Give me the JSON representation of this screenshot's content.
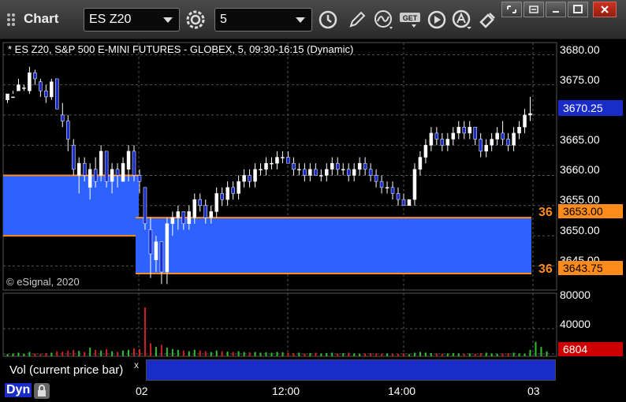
{
  "window": {
    "title": "Chart",
    "symbol": "ES Z20",
    "interval": "5"
  },
  "chart": {
    "header": "* ES Z20, S&P 500 E-MINI FUTURES - GLOBEX, 5, 09:30-16:15 (Dynamic)",
    "watermark": "© eSignal, 2020",
    "price_labels": [
      "3680.00",
      "3675.00",
      "3665.00",
      "3660.00",
      "3655.00",
      "3650.00",
      "3645.00"
    ],
    "current_price": "3670.25",
    "zone_upper": "3653.00",
    "zone_lower": "3643.75",
    "zone_tag": "36",
    "volume_labels": [
      "80000",
      "40000"
    ],
    "current_volume": "6804",
    "time_labels": [
      "02",
      "12:00",
      "14:00",
      "03"
    ],
    "study_label": "Vol (current price bar)",
    "study_close": "x",
    "footer_label": "Dyn",
    "colors": {
      "zone_fill": "#2e62ff",
      "zone_border": "#ff8c1a",
      "current_price": "#1a2cc8",
      "volume_label": "#cc0000",
      "candle_up": "#ffffff",
      "candle_down": "#1a2cc8",
      "volume_up": "#2fbf2f",
      "volume_down": "#cc2222"
    }
  },
  "chart_data": {
    "type": "candlestick",
    "title": "* ES Z20, S&P 500 E-MINI FUTURES - GLOBEX, 5, 09:30-16:15 (Dynamic)",
    "x_labels": [
      "02",
      "12:00",
      "14:00",
      "03"
    ],
    "y_range": [
      3641,
      3682
    ],
    "candles": [
      [
        3672.5,
        3673,
        3672,
        3673.5
      ],
      [
        3673,
        3674,
        3673.5,
        3673
      ],
      [
        3674,
        3676,
        3674,
        3675
      ],
      [
        3674.5,
        3675,
        3674,
        3674.5
      ],
      [
        3674,
        3678,
        3673.5,
        3677
      ],
      [
        3677,
        3677.5,
        3675,
        3676
      ],
      [
        3675.5,
        3676,
        3673,
        3674
      ],
      [
        3674,
        3675,
        3672,
        3673
      ],
      [
        3673,
        3676,
        3672.5,
        3675.5
      ],
      [
        3676,
        3676,
        3671,
        3671
      ],
      [
        3670,
        3672,
        3668,
        3669
      ],
      [
        3669,
        3670,
        3664,
        3666
      ],
      [
        3665,
        3666,
        3660,
        3661
      ],
      [
        3660,
        3663,
        3657,
        3662
      ],
      [
        3662,
        3663,
        3659,
        3660
      ],
      [
        3658,
        3662,
        3656,
        3661
      ],
      [
        3661,
        3663,
        3658,
        3659
      ],
      [
        3660,
        3665,
        3659,
        3664
      ],
      [
        3664,
        3664,
        3658,
        3659
      ],
      [
        3659,
        3662,
        3657,
        3661
      ],
      [
        3661,
        3662,
        3658,
        3660
      ],
      [
        3659,
        3663,
        3659,
        3662
      ],
      [
        3661,
        3665,
        3659,
        3664
      ],
      [
        3664,
        3665,
        3659,
        3660
      ],
      [
        3660,
        3661,
        3657,
        3659
      ],
      [
        3658,
        3656,
        3651,
        3652
      ],
      [
        3651,
        3653,
        3643,
        3647
      ],
      [
        3646,
        3650,
        3644,
        3649
      ],
      [
        3649,
        3648,
        3642,
        3644
      ],
      [
        3644,
        3653,
        3642,
        3652
      ],
      [
        3652,
        3654,
        3650,
        3653
      ],
      [
        3653,
        3655,
        3651,
        3654
      ],
      [
        3654,
        3654,
        3651,
        3652
      ],
      [
        3652,
        3655,
        3651,
        3654
      ],
      [
        3653,
        3657,
        3652,
        3656
      ],
      [
        3656,
        3657,
        3654,
        3655
      ],
      [
        3655,
        3656,
        3652,
        3653
      ],
      [
        3653,
        3655,
        3652,
        3654
      ],
      [
        3654,
        3658,
        3653,
        3657
      ],
      [
        3657,
        3658,
        3655,
        3656
      ],
      [
        3656,
        3659,
        3655,
        3658
      ],
      [
        3658,
        3659,
        3656,
        3657
      ],
      [
        3657,
        3660,
        3656,
        3659
      ],
      [
        3659,
        3661,
        3658,
        3660
      ],
      [
        3660,
        3661,
        3658,
        3659
      ],
      [
        3659,
        3662,
        3658,
        3661
      ],
      [
        3661,
        3662,
        3660,
        3661
      ],
      [
        3661,
        3663,
        3660,
        3662
      ],
      [
        3662,
        3663,
        3661,
        3662
      ],
      [
        3662,
        3664,
        3661,
        3663
      ],
      [
        3663,
        3664,
        3662,
        3663
      ],
      [
        3663,
        3664,
        3662,
        3662
      ],
      [
        3662,
        3663,
        3660,
        3661
      ],
      [
        3661,
        3662,
        3660,
        3661
      ],
      [
        3661,
        3662,
        3659,
        3660
      ],
      [
        3660,
        3662,
        3659,
        3661
      ],
      [
        3661,
        3662,
        3660,
        3660
      ],
      [
        3660,
        3661,
        3659,
        3660
      ],
      [
        3660,
        3662,
        3659,
        3661
      ],
      [
        3661,
        3663,
        3660,
        3662
      ],
      [
        3662,
        3663,
        3660,
        3661
      ],
      [
        3661,
        3662,
        3660,
        3661
      ],
      [
        3661,
        3662,
        3659,
        3660
      ],
      [
        3660,
        3662,
        3659,
        3661
      ],
      [
        3661,
        3663,
        3660,
        3662
      ],
      [
        3662,
        3663,
        3660,
        3661
      ],
      [
        3661,
        3662,
        3659,
        3660
      ],
      [
        3660,
        3661,
        3658,
        3659
      ],
      [
        3659,
        3660,
        3657,
        3658
      ],
      [
        3658,
        3659,
        3657,
        3658
      ],
      [
        3658,
        3659,
        3656,
        3657
      ],
      [
        3657,
        3658,
        3655,
        3656
      ],
      [
        3656,
        3657,
        3655,
        3655
      ],
      [
        3655,
        3656,
        3655,
        3656
      ],
      [
        3656,
        3662,
        3655,
        3661
      ],
      [
        3661,
        3664,
        3660,
        3663
      ],
      [
        3663,
        3666,
        3662,
        3665
      ],
      [
        3665,
        3668,
        3664,
        3667
      ],
      [
        3667,
        3668,
        3665,
        3666
      ],
      [
        3666,
        3667,
        3664,
        3665
      ],
      [
        3665,
        3667,
        3664,
        3666
      ],
      [
        3666,
        3668,
        3665,
        3667
      ],
      [
        3667,
        3669,
        3666,
        3668
      ],
      [
        3668,
        3669,
        3666,
        3667
      ],
      [
        3667,
        3669,
        3666,
        3668
      ],
      [
        3668,
        3668,
        3665,
        3666
      ],
      [
        3666,
        3667,
        3663,
        3664
      ],
      [
        3664,
        3666,
        3663,
        3665
      ],
      [
        3665,
        3667,
        3664,
        3666
      ],
      [
        3666,
        3668,
        3665,
        3667
      ],
      [
        3667,
        3669,
        3665,
        3666
      ],
      [
        3666,
        3667,
        3664,
        3665
      ],
      [
        3665,
        3668,
        3664,
        3667
      ],
      [
        3667,
        3669,
        3666,
        3668
      ],
      [
        3668,
        3671,
        3667,
        3670
      ],
      [
        3670,
        3673,
        3669,
        3670.25
      ]
    ],
    "volume_range": [
      0,
      80000
    ],
    "volumes": [
      3000,
      4000,
      5000,
      3500,
      6000,
      4000,
      3000,
      4500,
      5000,
      7000,
      6500,
      8000,
      9000,
      7500,
      6000,
      12000,
      9000,
      8000,
      10000,
      7000,
      6000,
      8000,
      9000,
      11000,
      10000,
      68000,
      18000,
      13000,
      16000,
      12000,
      10000,
      9000,
      8000,
      7000,
      9000,
      8000,
      7000,
      6000,
      8000,
      7000,
      6500,
      6000,
      7000,
      6000,
      5500,
      6000,
      5000,
      5500,
      5000,
      6000,
      5500,
      5000,
      4500,
      5000,
      4000,
      4500,
      5000,
      4000,
      4500,
      5000,
      4000,
      4500,
      5000,
      4000,
      3500,
      4000,
      4500,
      4000,
      3500,
      4000,
      3000,
      3500,
      4000,
      3000,
      5000,
      6000,
      5000,
      4500,
      4000,
      3500,
      4000,
      4500,
      4000,
      3500,
      4000,
      3500,
      4500,
      5000,
      4000,
      3500,
      4000,
      4500,
      5000,
      4000,
      3500,
      9000,
      20000,
      13000,
      6804
    ],
    "zones": [
      {
        "upper": 3660,
        "lower": 3650,
        "segment": "left"
      },
      {
        "upper": 3653,
        "lower": 3643.75,
        "segment": "right"
      }
    ]
  }
}
